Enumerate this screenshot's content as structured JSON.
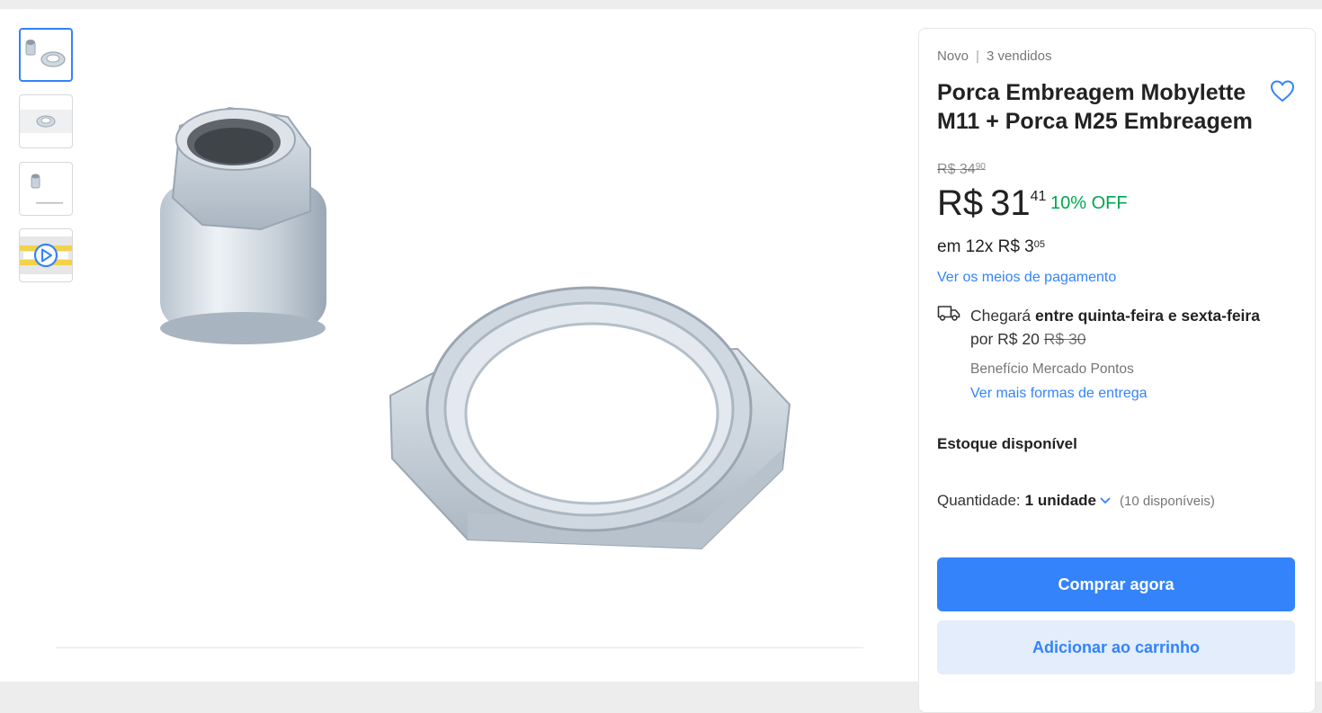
{
  "product": {
    "condition": "Novo",
    "sold": "3 vendidos",
    "title": "Porca Embreagem Mobylette M11 + Porca M25 Embreagem"
  },
  "pricing": {
    "old_currency": "R$",
    "old_integer": "34",
    "old_cents": "90",
    "currency": "R$",
    "integer": "31",
    "cents": "41",
    "discount": "10% OFF",
    "installments_prefix": "em 12x",
    "installment_currency": "R$",
    "installment_integer": "3",
    "installment_cents": "05",
    "payment_link": "Ver os meios de pagamento"
  },
  "shipping": {
    "prefix": "Chegará",
    "window": "entre quinta-feira e sexta-feira",
    "price_prefix": "por",
    "price": "R$ 20",
    "old_price": "R$ 30",
    "benefit": "Benefício Mercado Pontos",
    "link": "Ver mais formas de entrega"
  },
  "stock": {
    "label": "Estoque disponível",
    "quantity_label": "Quantidade:",
    "quantity_value": "1 unidade",
    "available": "(10 disponíveis)"
  },
  "actions": {
    "buy_now": "Comprar agora",
    "add_to_cart": "Adicionar ao carrinho"
  },
  "colors": {
    "accent": "#3483fa",
    "discount": "#00a650",
    "secondary_button": "#e3edfb"
  },
  "icons": {
    "favorite": "heart-icon",
    "shipping": "truck-icon",
    "quantity": "chevron-down-icon",
    "video": "play-icon"
  }
}
